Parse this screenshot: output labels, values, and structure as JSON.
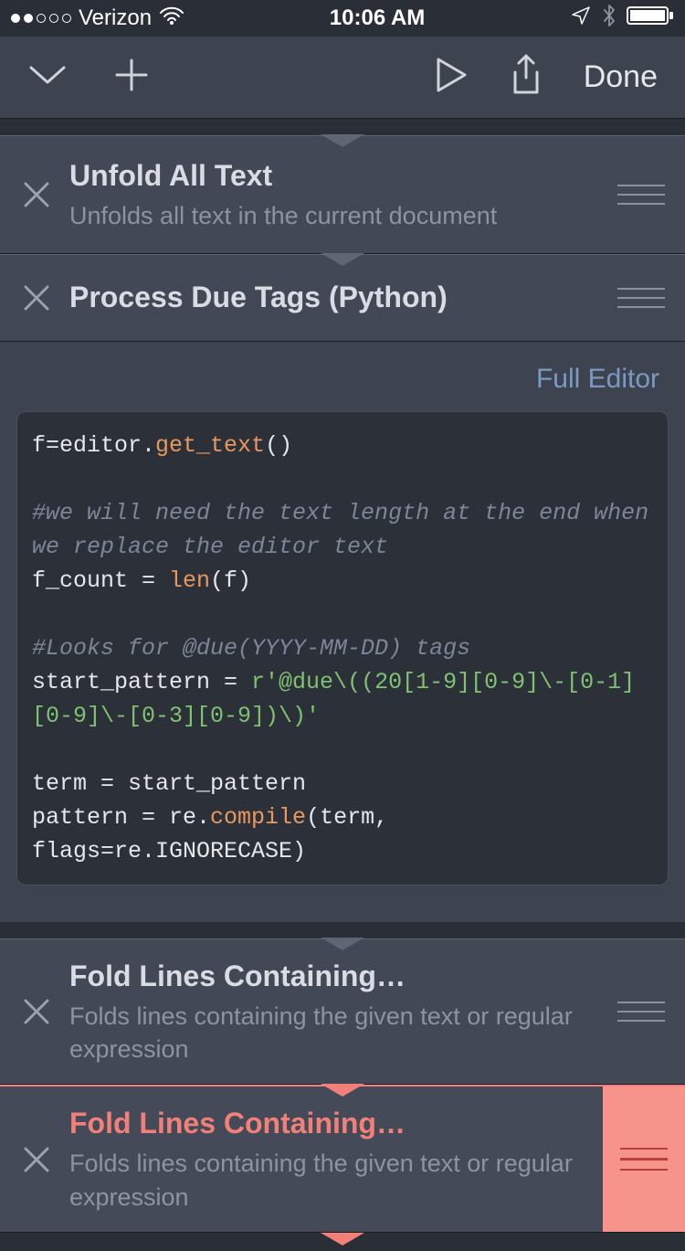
{
  "status": {
    "carrier": "Verizon",
    "time": "10:06 AM"
  },
  "toolbar": {
    "done": "Done"
  },
  "actions": [
    {
      "title": "Unfold All Text",
      "sub": "Unfolds all text in the current document"
    },
    {
      "title": "Process Due Tags (Python)"
    },
    {
      "title": "Fold Lines Containing…",
      "sub": "Folds lines containing the given text or regular expression"
    },
    {
      "title": "Fold Lines Containing…",
      "sub": "Folds lines containing the given text or regular expression"
    }
  ],
  "editor": {
    "full_editor": "Full Editor",
    "code": {
      "l1a": "f=editor.",
      "l1b": "get_text",
      "l1c": "()",
      "l2": "#we will need the text length at the end when we replace the editor text",
      "l3a": "f_count = ",
      "l3b": "len",
      "l3c": "(f)",
      "l4": "#Looks for @due(YYYY-MM-DD) tags",
      "l5a": "start_pattern = ",
      "l5b": "r'@due\\((20[1-9][0-9]\\-[0-1][0-9]\\-[0-3][0-9])\\)'",
      "l6": "term = start_pattern",
      "l7a": "pattern = re.",
      "l7b": "compile",
      "l7c": "(term, flags=re.IGNORECASE)"
    }
  }
}
